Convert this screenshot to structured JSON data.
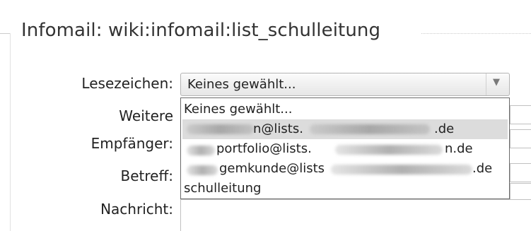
{
  "fieldset": {
    "legend": "Infomail: wiki:infomail:list_schulleitung"
  },
  "form": {
    "bookmark_label": "Lesezeichen:",
    "more_label_line1": "Weitere",
    "more_label_line2": "Empfänger:",
    "subject_label": "Betreff:",
    "message_label": "Nachricht:",
    "bookmark_selected": "Keines gewählt...",
    "bookmark_arrow_icon": "chevron-down-icon"
  },
  "dropdown": {
    "options": [
      {
        "text": "Keines gewählt...",
        "selected": false
      },
      {
        "text_visible_suffix": "n@lists.",
        "text_end": ".de",
        "selected": true
      },
      {
        "text_visible_suffix": "portfolio@lists.",
        "text_end": "n.de",
        "selected": false
      },
      {
        "text_visible_suffix": "gemkunde@lists",
        "text_end": ".de",
        "selected": false
      },
      {
        "text": "schulleitung",
        "selected": false
      }
    ]
  },
  "colors": {
    "highlight": "#dcdcdc",
    "border": "#b4b4b4"
  }
}
